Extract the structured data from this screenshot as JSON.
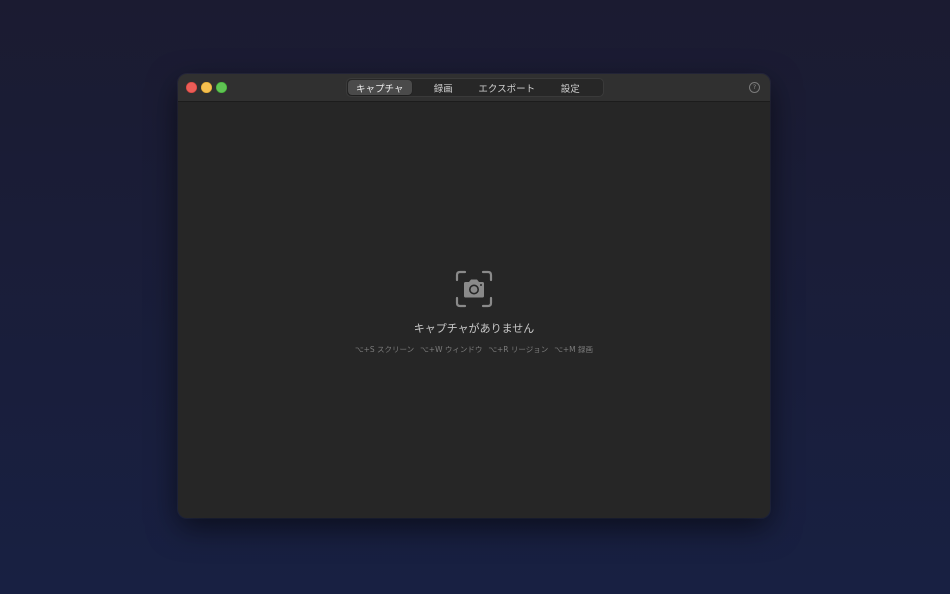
{
  "window": {
    "tabs": [
      {
        "label": "キャプチャ",
        "active": true
      },
      {
        "label": "録画",
        "active": false
      },
      {
        "label": "エクスポート",
        "active": false
      },
      {
        "label": "設定",
        "active": false
      }
    ],
    "help_label": "?"
  },
  "empty_state": {
    "icon": "camera-viewfinder-icon",
    "title": "キャプチャがありません",
    "shortcuts": [
      "⌥+S スクリーン",
      "⌥+W ウィンドウ",
      "⌥+R リージョン",
      "⌥+M 録画"
    ]
  },
  "colors": {
    "close": "#ec5d57",
    "minimize": "#f5bf4f",
    "zoom": "#5fc453",
    "window_bg": "#262626",
    "titlebar_bg": "#303030"
  }
}
